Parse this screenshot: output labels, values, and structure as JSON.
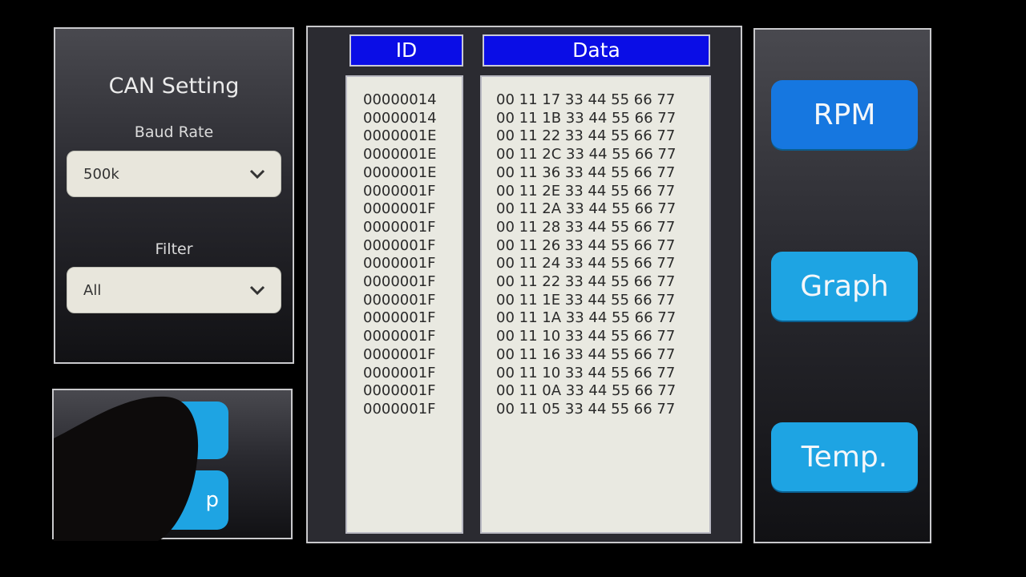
{
  "settings": {
    "title": "CAN Setting",
    "baud_rate_label": "Baud Rate",
    "baud_rate_value": "500k",
    "filter_label": "Filter",
    "filter_value": "All"
  },
  "controls": {
    "stop_button_label": "p"
  },
  "table": {
    "id_header": "ID",
    "data_header": "Data",
    "rows": [
      {
        "id": "00000014",
        "data": "00 11 17 33 44 55 66 77"
      },
      {
        "id": "00000014",
        "data": "00 11 1B 33 44 55 66 77"
      },
      {
        "id": "0000001E",
        "data": "00 11 22 33 44 55 66 77"
      },
      {
        "id": "0000001E",
        "data": "00 11 2C 33 44 55 66 77"
      },
      {
        "id": "0000001E",
        "data": "00 11 36 33 44 55 66 77"
      },
      {
        "id": "0000001F",
        "data": "00 11 2E 33 44 55 66 77"
      },
      {
        "id": "0000001F",
        "data": "00 11 2A 33 44 55 66 77"
      },
      {
        "id": "0000001F",
        "data": "00 11 28 33 44 55 66 77"
      },
      {
        "id": "0000001F",
        "data": "00 11 26 33 44 55 66 77"
      },
      {
        "id": "0000001F",
        "data": "00 11 24 33 44 55 66 77"
      },
      {
        "id": "0000001F",
        "data": "00 11 22 33 44 55 66 77"
      },
      {
        "id": "0000001F",
        "data": "00 11 1E 33 44 55 66 77"
      },
      {
        "id": "0000001F",
        "data": "00 11 1A 33 44 55 66 77"
      },
      {
        "id": "0000001F",
        "data": "00 11 10 33 44 55 66 77"
      },
      {
        "id": "0000001F",
        "data": "00 11 16 33 44 55 66 77"
      },
      {
        "id": "0000001F",
        "data": "00 11 10 33 44 55 66 77"
      },
      {
        "id": "0000001F",
        "data": "00 11 0A 33 44 55 66 77"
      },
      {
        "id": "0000001F",
        "data": "00 11 05 33 44 55 66 77"
      }
    ]
  },
  "nav": {
    "rpm_label": "RPM",
    "graph_label": "Graph",
    "temp_label": "Temp."
  },
  "colors": {
    "header_blue": "#0a0de6",
    "button_blue": "#1ea4e3",
    "rpm_blue": "#1677e0"
  }
}
